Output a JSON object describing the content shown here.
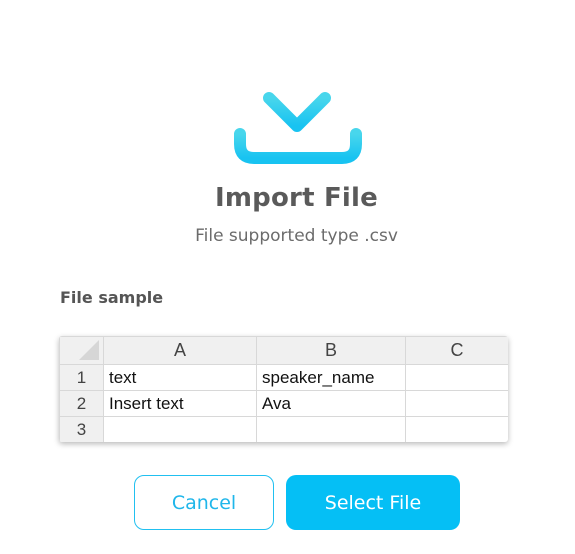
{
  "header": {
    "icon": "download-icon",
    "title": "Import File",
    "subtitle": "File supported type .csv"
  },
  "sample": {
    "label": "File sample",
    "columns": [
      "A",
      "B",
      "C"
    ],
    "rows": [
      {
        "num": "1",
        "cells": [
          "text",
          "speaker_name",
          ""
        ]
      },
      {
        "num": "2",
        "cells": [
          "Insert text",
          "Ava",
          ""
        ]
      },
      {
        "num": "3",
        "cells": [
          "",
          "",
          ""
        ]
      }
    ]
  },
  "actions": {
    "cancel_label": "Cancel",
    "select_label": "Select File"
  },
  "colors": {
    "accent": "#05bff5",
    "icon_gradient_top": "#43d4ee",
    "icon_gradient_bottom": "#19c4f0"
  }
}
